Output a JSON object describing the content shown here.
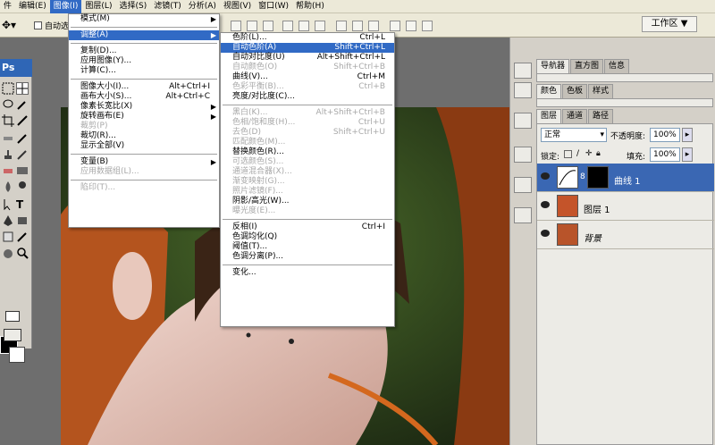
{
  "menubar": {
    "items": [
      {
        "label": "件"
      },
      {
        "label": "编辑(E)"
      },
      {
        "label": "图像(I)",
        "active": true
      },
      {
        "label": "图层(L)"
      },
      {
        "label": "选择(S)"
      },
      {
        "label": "滤镜(T)"
      },
      {
        "label": "分析(A)"
      },
      {
        "label": "视图(V)"
      },
      {
        "label": "窗口(W)"
      },
      {
        "label": "帮助(H)"
      }
    ]
  },
  "options": {
    "auto_select": "自动选",
    "workspace": "工作区 ▼"
  },
  "toolbox": {
    "logo": "Ps"
  },
  "image_menu": {
    "items": [
      {
        "label": "模式(M)",
        "sub": true
      },
      {
        "sep": true
      },
      {
        "label": "调整(A)",
        "sub": true,
        "hl": true
      },
      {
        "sep": true
      },
      {
        "label": "复制(D)..."
      },
      {
        "label": "应用图像(Y)..."
      },
      {
        "label": "计算(C)..."
      },
      {
        "sep": true
      },
      {
        "label": "图像大小(I)...",
        "sc": "Alt+Ctrl+I"
      },
      {
        "label": "画布大小(S)...",
        "sc": "Alt+Ctrl+C"
      },
      {
        "label": "像素长宽比(X)",
        "sub": true
      },
      {
        "label": "旋转画布(E)",
        "sub": true
      },
      {
        "label": "裁剪(P)",
        "dis": true
      },
      {
        "label": "裁切(R)..."
      },
      {
        "label": "显示全部(V)"
      },
      {
        "sep": true
      },
      {
        "label": "变量(B)",
        "sub": true
      },
      {
        "label": "应用数据组(L)...",
        "dis": true
      },
      {
        "sep": true
      },
      {
        "label": "陷印(T)...",
        "dis": true
      }
    ]
  },
  "adjust_menu": {
    "items": [
      {
        "label": "色阶(L)...",
        "sc": "Ctrl+L"
      },
      {
        "label": "自动色阶(A)",
        "sc": "Shift+Ctrl+L",
        "hl": true
      },
      {
        "label": "自动对比度(U)",
        "sc": "Alt+Shift+Ctrl+L"
      },
      {
        "label": "自动颜色(O)",
        "sc": "Shift+Ctrl+B",
        "dis": true
      },
      {
        "label": "曲线(V)...",
        "sc": "Ctrl+M"
      },
      {
        "label": "色彩平衡(B)...",
        "sc": "Ctrl+B",
        "dis": true
      },
      {
        "label": "亮度/对比度(C)..."
      },
      {
        "sep": true
      },
      {
        "label": "黑白(K)...",
        "sc": "Alt+Shift+Ctrl+B",
        "dis": true
      },
      {
        "label": "色相/饱和度(H)...",
        "sc": "Ctrl+U",
        "dis": true
      },
      {
        "label": "去色(D)",
        "sc": "Shift+Ctrl+U",
        "dis": true
      },
      {
        "label": "匹配颜色(M)...",
        "dis": true
      },
      {
        "label": "替换颜色(R)..."
      },
      {
        "label": "可选颜色(S)...",
        "dis": true
      },
      {
        "label": "通道混合器(X)...",
        "dis": true
      },
      {
        "label": "渐变映射(G)...",
        "dis": true
      },
      {
        "label": "照片滤镜(F)...",
        "dis": true
      },
      {
        "label": "阴影/高光(W)..."
      },
      {
        "label": "曝光度(E)...",
        "dis": true
      },
      {
        "sep": true
      },
      {
        "label": "反相(I)",
        "sc": "Ctrl+I"
      },
      {
        "label": "色调均化(Q)"
      },
      {
        "label": "阈值(T)..."
      },
      {
        "label": "色调分离(P)..."
      },
      {
        "sep": true
      },
      {
        "label": "变化..."
      }
    ]
  },
  "panels": {
    "group1": [
      "导航器",
      "直方图",
      "信息"
    ],
    "group2": [
      "颜色",
      "色板",
      "样式"
    ],
    "group3": [
      "图层",
      "通道",
      "路径"
    ],
    "blend_mode": "正常",
    "opacity_label": "不透明度:",
    "opacity_value": "100%",
    "lock_label": "锁定:",
    "fill_label": "填充:",
    "fill_value": "100%",
    "layers": [
      {
        "name": "曲线 1",
        "active": true
      },
      {
        "name": "图层 1"
      },
      {
        "name": "背景"
      }
    ]
  },
  "colors": {
    "highlight": "#316ac5",
    "layer_active": "#3a67b3"
  }
}
